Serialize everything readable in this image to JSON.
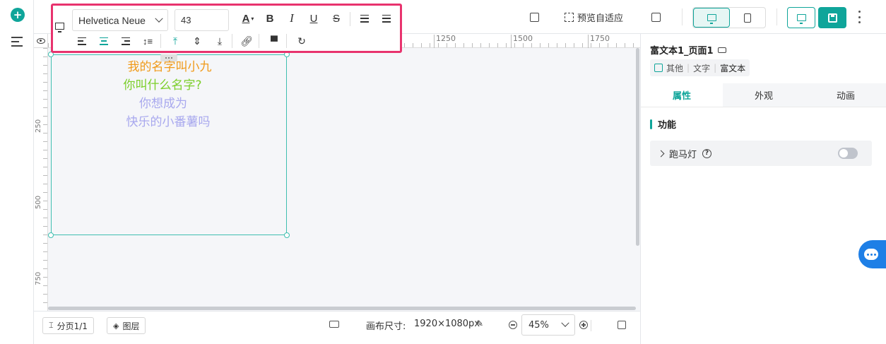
{
  "toolbar": {
    "font_family": "Helvetica Neue",
    "font_size": "43"
  },
  "topbar": {
    "preview_fit_label": "预览自适应"
  },
  "canvas": {
    "ruler_top": [
      "1250",
      "1500",
      "1750"
    ],
    "ruler_left": [
      "250",
      "500",
      "750"
    ],
    "text_lines": [
      {
        "text": "我的名字叫小九",
        "color": "#f09a1a"
      },
      {
        "text": "你叫什么名字?",
        "color": "#7ccf2a"
      },
      {
        "text": "你想成为",
        "color": "#a8a8ee"
      },
      {
        "text": "快乐的小番薯吗",
        "color": "#a8a8ee"
      }
    ]
  },
  "bottombar": {
    "paging_label": "分页1/1",
    "layers_label": "图层",
    "canvas_size_label": "画布尺寸:",
    "canvas_size_value": "1920×1080px",
    "zoom_value": "45%"
  },
  "rightpanel": {
    "title": "富文本1_页面1",
    "tags": [
      "其他",
      "文字",
      "富文本"
    ],
    "tabs": [
      "属性",
      "外观",
      "动画"
    ],
    "section_title": "功能",
    "marquee_label": "跑马灯",
    "marquee_enabled": false
  },
  "colors": {
    "accent": "#0fa59a",
    "highlight_border": "#e8336e",
    "selection": "#3fbfb0"
  }
}
